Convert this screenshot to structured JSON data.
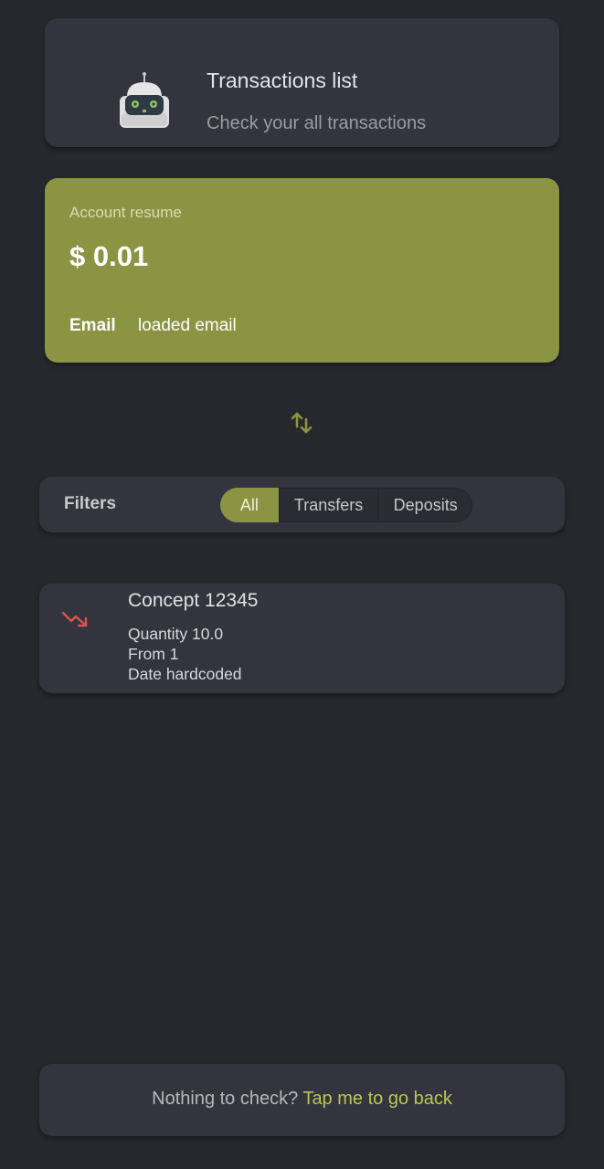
{
  "header": {
    "title": "Transactions list",
    "subtitle": "Check your all transactions",
    "avatar_icon": "robot-icon"
  },
  "account": {
    "label": "Account resume",
    "balance": "$ 0.01",
    "email_key": "Email",
    "email_value": "loaded email",
    "accent_color": "#8b9443"
  },
  "swap": {
    "icon": "swap-vertical-icon"
  },
  "filters": {
    "label": "Filters",
    "options": [
      "All",
      "Transfers",
      "Deposits"
    ],
    "selected": "All"
  },
  "transactions": [
    {
      "icon": "trending-down-icon",
      "title": "Concept 12345",
      "quantity": "Quantity 10.0",
      "from": "From 1",
      "date": "Date hardcoded"
    }
  ],
  "footer": {
    "prefix": "Nothing to check?",
    "link": "Tap me to go back",
    "link_color": "#b9c74b"
  }
}
